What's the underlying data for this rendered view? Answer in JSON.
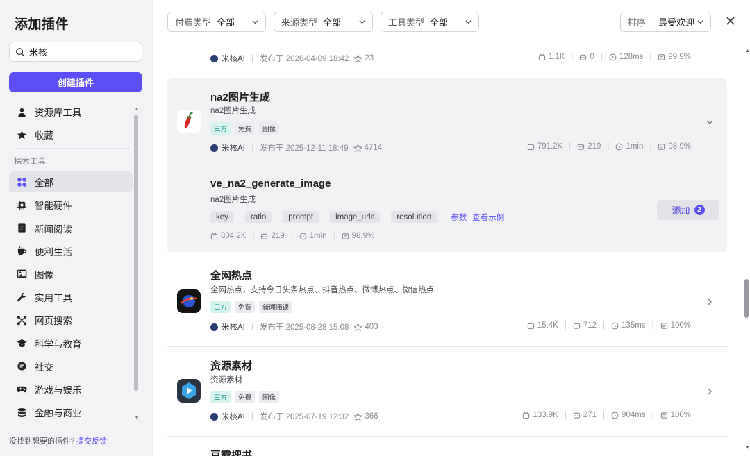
{
  "sidebar": {
    "title": "添加插件",
    "search_value": "米核",
    "create_label": "创建插件",
    "top_items": [
      {
        "label": "资源库工具",
        "icon": "user-icon"
      },
      {
        "label": "收藏",
        "icon": "star-icon"
      }
    ],
    "section_label": "探索工具",
    "items": [
      {
        "label": "全部",
        "icon": "grid-icon",
        "active": true
      },
      {
        "label": "智能硬件",
        "icon": "chip-icon"
      },
      {
        "label": "新闻阅读",
        "icon": "book-icon"
      },
      {
        "label": "便利生活",
        "icon": "cup-icon"
      },
      {
        "label": "图像",
        "icon": "image-icon"
      },
      {
        "label": "实用工具",
        "icon": "wrench-icon"
      },
      {
        "label": "网页搜索",
        "icon": "network-icon"
      },
      {
        "label": "科学与教育",
        "icon": "graduation-cap-icon"
      },
      {
        "label": "社交",
        "icon": "chat-bubble-icon"
      },
      {
        "label": "游戏与娱乐",
        "icon": "gamepad-icon"
      },
      {
        "label": "金融与商业",
        "icon": "database-icon"
      }
    ],
    "footer_text": "没找到想要的插件?",
    "footer_link": "提交反馈"
  },
  "filters": {
    "pay": {
      "label": "付费类型",
      "value": "全部"
    },
    "source": {
      "label": "来源类型",
      "value": "全部"
    },
    "tool": {
      "label": "工具类型",
      "value": "全部"
    },
    "sort": {
      "label": "排序",
      "value": "最受欢迎"
    }
  },
  "cards": [
    {
      "author": "米核AI",
      "published": "发布于 2026-04-09 18:42",
      "stars": "23",
      "uses": "1.1K",
      "bots": "0",
      "latency": "128ms",
      "success": "99.9%"
    },
    {
      "title": "na2图片生成",
      "desc": "na2图片生成",
      "tags": [
        "三方",
        "免费",
        "图像"
      ],
      "author": "米核AI",
      "published": "发布于 2025-12-11 18:49",
      "stars": "4714",
      "uses": "791.2K",
      "bots": "219",
      "latency": "1min",
      "success": "98.9%",
      "tool": {
        "name": "ve_na2_generate_image",
        "desc": "na2图片生成",
        "params": [
          "key",
          "ratio",
          "prompt",
          "image_urls",
          "resolution"
        ],
        "link_params": "参数",
        "link_example": "查看示例",
        "uses": "804.2K",
        "bots": "219",
        "latency": "1min",
        "success": "98.9%",
        "add_label": "添加",
        "add_count": "2"
      }
    },
    {
      "title": "全网热点",
      "desc": "全网热点，支持今日头条热点、抖音热点、微博热点、微信热点",
      "tags": [
        "三方",
        "免费",
        "新闻阅读"
      ],
      "author": "米核AI",
      "published": "发布于 2025-08-28 15:08",
      "stars": "403",
      "uses": "15.4K",
      "bots": "712",
      "latency": "135ms",
      "success": "100%"
    },
    {
      "title": "资源素材",
      "desc": "资源素材",
      "tags": [
        "三方",
        "免费",
        "图像"
      ],
      "author": "米核AI",
      "published": "发布于 2025-07-19 12:32",
      "stars": "366",
      "uses": "133.9K",
      "bots": "271",
      "latency": "904ms",
      "success": "100%"
    },
    {
      "title": "豆瓣搜书"
    }
  ],
  "colors": {
    "accent": "#5b4ff5",
    "third_party_tag_bg": "#d6f3ef",
    "third_party_tag_fg": "#1a8f82"
  }
}
